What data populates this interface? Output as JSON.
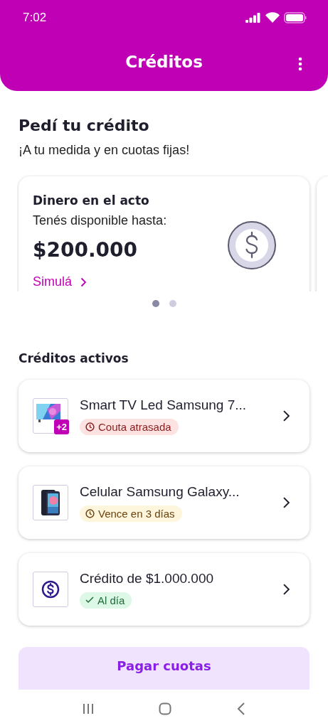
{
  "status_bar": {
    "time": "7:02"
  },
  "header": {
    "title": "Créditos"
  },
  "offer": {
    "title": "Pedí tu crédito",
    "subtitle": "¡A tu medida y en cuotas fijas!"
  },
  "carousel": {
    "cards": [
      {
        "title": "Dinero en el acto",
        "label": "Tenés disponible hasta:",
        "amount": "$200.000",
        "link": "Simulá"
      }
    ],
    "dots": [
      {
        "selected": true
      },
      {
        "selected": false
      }
    ]
  },
  "active_credits": {
    "title": "Créditos activos",
    "items": [
      {
        "kind": "product",
        "name": "Smart TV Led Samsung 7...",
        "extra": "+2",
        "status": {
          "kind": "late",
          "label": "Couta atrasada"
        }
      },
      {
        "kind": "phone",
        "name": "Celular Samsung Galaxy...",
        "status": {
          "kind": "due",
          "label": "Vence en 3 días"
        }
      },
      {
        "kind": "cash",
        "name": "Crédito de $1.000.000",
        "status": {
          "kind": "ok",
          "label": "Al día"
        }
      }
    ]
  },
  "pay_button": {
    "label": "Pagar cuotas"
  }
}
